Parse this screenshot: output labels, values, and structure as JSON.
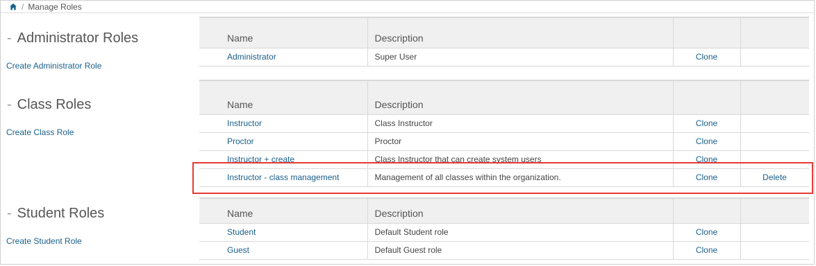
{
  "breadcrumb": {
    "home_icon": "home-icon",
    "separator": "/",
    "current": "Manage Roles"
  },
  "table_headers": {
    "name": "Name",
    "description": "Description"
  },
  "sections": {
    "admin": {
      "title": "Administrator Roles",
      "create_link": "Create Administrator Role",
      "rows": [
        {
          "name": "Administrator",
          "description": "Super User",
          "clone": "Clone",
          "delete": ""
        }
      ]
    },
    "class": {
      "title": "Class Roles",
      "create_link": "Create Class Role",
      "rows": [
        {
          "name": "Instructor",
          "description": "Class Instructor",
          "clone": "Clone",
          "delete": ""
        },
        {
          "name": "Proctor",
          "description": "Proctor",
          "clone": "Clone",
          "delete": ""
        },
        {
          "name": "Instructor + create",
          "description": "Class Instructor that can create system users",
          "clone": "Clone",
          "delete": ""
        },
        {
          "name": "Instructor - class management",
          "description": "Management of all classes within the organization.",
          "clone": "Clone",
          "delete": "Delete"
        }
      ]
    },
    "student": {
      "title": "Student Roles",
      "create_link": "Create Student Role",
      "rows": [
        {
          "name": "Student",
          "description": "Default Student role",
          "clone": "Clone",
          "delete": ""
        },
        {
          "name": "Guest",
          "description": "Default Guest role",
          "clone": "Clone",
          "delete": ""
        }
      ]
    }
  },
  "colors": {
    "link": "#1a5f8a",
    "highlight": "#e53935",
    "header_bg": "#f0f0f0"
  }
}
